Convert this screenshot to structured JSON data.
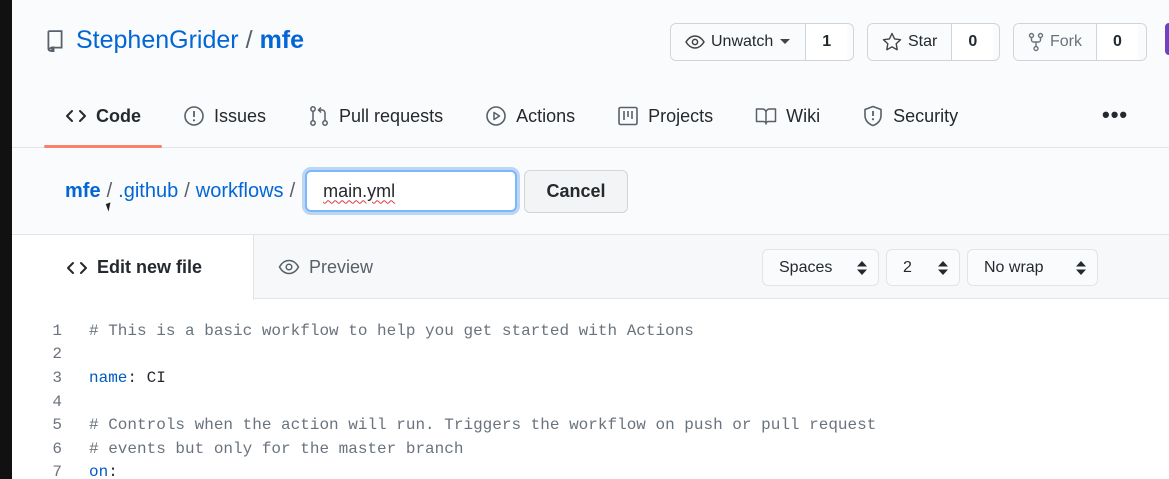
{
  "repo": {
    "owner": "StephenGrider",
    "separator": "/",
    "name": "mfe"
  },
  "header_actions": {
    "watch": {
      "label": "Unwatch",
      "count": "1"
    },
    "star": {
      "label": "Star",
      "count": "0"
    },
    "fork": {
      "label": "Fork",
      "count": "0"
    }
  },
  "nav_tabs": [
    {
      "label": "Code",
      "icon": "code-icon",
      "selected": true
    },
    {
      "label": "Issues",
      "icon": "issue-icon"
    },
    {
      "label": "Pull requests",
      "icon": "pull-request-icon"
    },
    {
      "label": "Actions",
      "icon": "play-icon"
    },
    {
      "label": "Projects",
      "icon": "project-icon"
    },
    {
      "label": "Wiki",
      "icon": "book-icon"
    },
    {
      "label": "Security",
      "icon": "shield-icon"
    }
  ],
  "more_label": "•••",
  "breadcrumb": {
    "items": [
      "mfe",
      ".github",
      "workflows"
    ],
    "separator": "/"
  },
  "filename_value": "main.yml",
  "cancel_label": "Cancel",
  "editor": {
    "tabs": {
      "edit": "Edit new file",
      "preview": "Preview"
    },
    "indent_mode": "Spaces",
    "indent_size": "2",
    "wrap_mode": "No wrap",
    "lines": [
      {
        "n": "1",
        "text": "# This is a basic workflow to help you get started with Actions"
      },
      {
        "n": "2",
        "text": ""
      },
      {
        "n": "3",
        "key": "name",
        "rest": ": CI"
      },
      {
        "n": "4",
        "text": ""
      },
      {
        "n": "5",
        "text": "# Controls when the action will run. Triggers the workflow on push or pull request"
      },
      {
        "n": "6",
        "text": "# events but only for the master branch"
      },
      {
        "n": "7",
        "key": "on",
        "rest": ":"
      }
    ]
  },
  "colors": {
    "link": "#0366d6",
    "tab_underline": "#f9826c",
    "focus_ring": "#79b8ff",
    "yaml_key": "#005cc5",
    "comment": "#6a737d"
  }
}
